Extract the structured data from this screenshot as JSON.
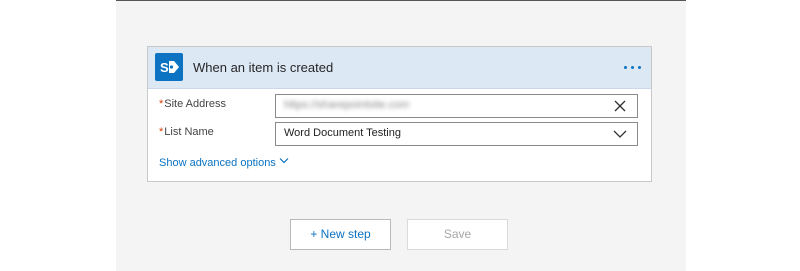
{
  "trigger_card": {
    "title": "When an item is created",
    "app_icon": "sharepoint-icon",
    "menu_icon": "more-options-icon",
    "fields": [
      {
        "label": "Site Address",
        "required": true,
        "value": "https://sharepointsite.com",
        "value_blurred": true,
        "action_icon": "clear-icon"
      },
      {
        "label": "List Name",
        "required": true,
        "value": "Word Document Testing",
        "action_icon": "chevron-down-icon"
      }
    ],
    "advanced_label": "Show advanced options"
  },
  "actions": {
    "new_step_label": "+ New step",
    "save_label": "Save"
  },
  "colors": {
    "accent": "#0b73c2",
    "header_bg": "#dde8f5",
    "required_mark": "#d83b01",
    "canvas_bg": "#f4f4f4"
  }
}
